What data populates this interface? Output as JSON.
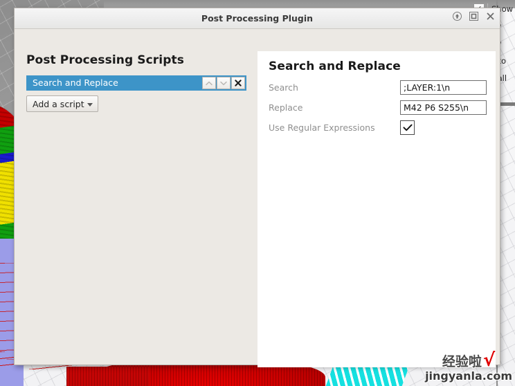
{
  "window": {
    "title": "Post Processing Plugin",
    "controls": [
      {
        "name": "shade-button",
        "icon": "arrow-up-icon"
      },
      {
        "name": "maximize-button",
        "icon": "square-icon"
      },
      {
        "name": "close-button",
        "icon": "close-icon"
      }
    ]
  },
  "left_pane": {
    "heading": "Post Processing Scripts",
    "scripts": [
      {
        "name": "Search and Replace",
        "selected": true,
        "move_up_label": "⌃",
        "move_down_label": "⌄",
        "remove_label": "✖"
      }
    ],
    "add_script_label": "Add a script"
  },
  "right_pane": {
    "heading": "Search and Replace",
    "fields": [
      {
        "label": "Search",
        "type": "text",
        "value": ";LAYER:1\\n"
      },
      {
        "label": "Replace",
        "type": "text",
        "value": "M42 P6 S255\\n"
      },
      {
        "label": "Use Regular Expressions",
        "type": "checkbox",
        "checked": true,
        "value": "✓"
      }
    ]
  },
  "background_panel": {
    "rows": [
      {
        "checkbox": "✓",
        "label": "Show"
      },
      {
        "checkbox": "",
        "label": "ow"
      },
      {
        "checkbox": "",
        "label": "ow"
      },
      {
        "checkbox": "",
        "label": "otto"
      },
      {
        "checkbox": "",
        "label": "Wall"
      }
    ]
  },
  "watermark": {
    "cn": "经验啦",
    "tick": "√",
    "url": "jingyanla.com"
  },
  "colors": {
    "selection_blue": "#3d94c8",
    "dialog_bg": "#ece9e4",
    "panel_white": "#ffffff",
    "label_grey": "#8f8f8f",
    "titlebar": "#eeeeec"
  }
}
